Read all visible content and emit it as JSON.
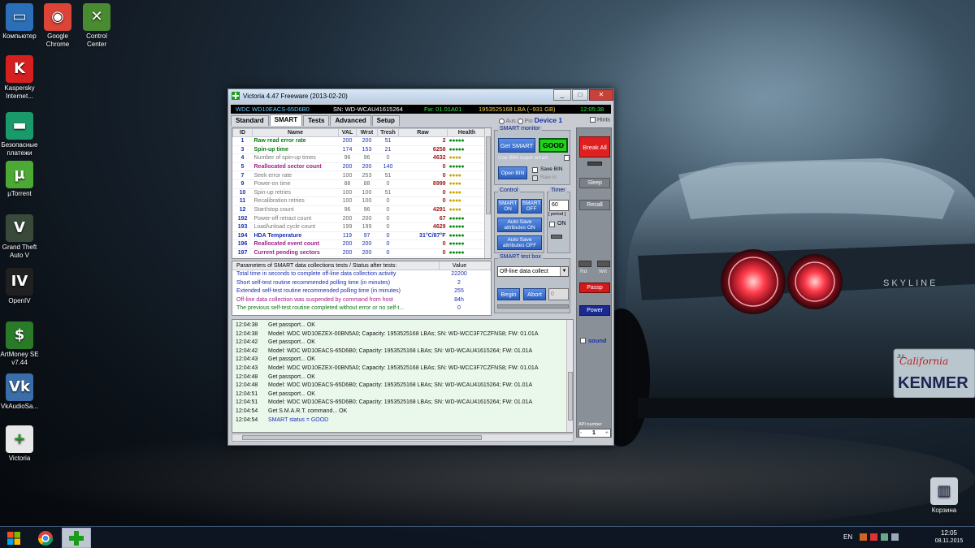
{
  "desktop_icons": [
    {
      "label": "Компьютер",
      "icon": "computer-icon",
      "color": "#2b6fb8"
    },
    {
      "label": "Google Chrome",
      "icon": "chrome-icon",
      "color": "#db4437"
    },
    {
      "label": "Control Center",
      "icon": "tools-icon",
      "color": "#4a8a30"
    },
    {
      "label": "Kaspersky Internet...",
      "icon": "kaspersky-icon",
      "color": "#d62020"
    },
    {
      "label": "Безопасные платежи",
      "icon": "payment-icon",
      "color": "#1a9a6a"
    },
    {
      "label": "µTorrent",
      "icon": "utorrent-icon",
      "color": "#4caa34"
    },
    {
      "label": "Grand Theft Auto V",
      "icon": "gta-icon",
      "color": "#3a4a3a"
    },
    {
      "label": "OpenIV",
      "icon": "openiv-icon",
      "color": "#202020"
    },
    {
      "label": "ArtMoney SE v7.44",
      "icon": "artmoney-icon",
      "color": "#2a7a2a"
    },
    {
      "label": "VkAudioSa...",
      "icon": "vkaudio-icon",
      "color": "#3a6ea8"
    },
    {
      "label": "Victoria",
      "icon": "victoria-icon",
      "color": "#e8e8e8"
    },
    {
      "label": "Корзина",
      "icon": "recycle-bin-icon",
      "color": "#c8d0d8"
    }
  ],
  "window": {
    "title": "Victoria 4.47  Freeware (2013-02-20)",
    "controls": [
      "_",
      "□",
      "✕"
    ]
  },
  "infobar": {
    "model": "WDC WD10EACS-65D6B0",
    "serial": "SN: WD-WCAU41615264",
    "firmware": "Fw: 01.01A01",
    "lba": "1953525168 LBA (~931 GB)",
    "time": "12:05:38"
  },
  "tabs": [
    "Standard",
    "SMART",
    "Tests",
    "Advanced",
    "Setup"
  ],
  "active_tab": "SMART",
  "device_row": {
    "opt1": "Aus",
    "opt2": "Pio",
    "device": "Device 1",
    "hints": "Hints"
  },
  "smart_table": {
    "headers": [
      "ID",
      "Name",
      "VAL",
      "Wrst",
      "Tresh",
      "Raw",
      "Health"
    ],
    "rows": [
      {
        "id": "1",
        "name": "Raw read error rate",
        "val": "200",
        "wrst": "200",
        "tresh": "51",
        "raw": "2",
        "health": "●●●●●",
        "color": "#0a7a12",
        "bold": true,
        "hcolor": "#0a8a12"
      },
      {
        "id": "3",
        "name": "Spin-up time",
        "val": "174",
        "wrst": "153",
        "tresh": "21",
        "raw": "6258",
        "health": "●●●●●",
        "color": "#0a7a12",
        "bold": true,
        "hcolor": "#0a8a12"
      },
      {
        "id": "4",
        "name": "Number of spin-up times",
        "val": "96",
        "wrst": "96",
        "tresh": "0",
        "raw": "4632",
        "health": "●●●●",
        "color": "#777777",
        "bold": false,
        "hcolor": "#c8a800"
      },
      {
        "id": "5",
        "name": "Reallocated sector count",
        "val": "200",
        "wrst": "200",
        "tresh": "140",
        "raw": "0",
        "health": "●●●●●",
        "color": "#a0208a",
        "bold": true,
        "hcolor": "#0a8a12"
      },
      {
        "id": "7",
        "name": "Seek error rate",
        "val": "100",
        "wrst": "253",
        "tresh": "51",
        "raw": "0",
        "health": "●●●●",
        "color": "#777777",
        "bold": false,
        "hcolor": "#c8a800"
      },
      {
        "id": "9",
        "name": "Power-on time",
        "val": "88",
        "wrst": "88",
        "tresh": "0",
        "raw": "8999",
        "health": "●●●●",
        "color": "#777777",
        "bold": false,
        "hcolor": "#c8a800"
      },
      {
        "id": "10",
        "name": "Spin-up retries",
        "val": "100",
        "wrst": "100",
        "tresh": "51",
        "raw": "0",
        "health": "●●●●",
        "color": "#777777",
        "bold": false,
        "hcolor": "#c8a800"
      },
      {
        "id": "11",
        "name": "Recalibration retries",
        "val": "100",
        "wrst": "100",
        "tresh": "0",
        "raw": "0",
        "health": "●●●●",
        "color": "#777777",
        "bold": false,
        "hcolor": "#c8a800"
      },
      {
        "id": "12",
        "name": "Start/stop count",
        "val": "96",
        "wrst": "96",
        "tresh": "0",
        "raw": "4291",
        "health": "●●●●",
        "color": "#777777",
        "bold": false,
        "hcolor": "#c8a800"
      },
      {
        "id": "192",
        "name": "Power-off retract count",
        "val": "200",
        "wrst": "200",
        "tresh": "0",
        "raw": "67",
        "health": "●●●●●",
        "color": "#777777",
        "bold": false,
        "hcolor": "#0a8a12"
      },
      {
        "id": "193",
        "name": "Load/unload cycle count",
        "val": "199",
        "wrst": "199",
        "tresh": "0",
        "raw": "4629",
        "health": "●●●●●",
        "color": "#777777",
        "bold": false,
        "hcolor": "#0a8a12"
      },
      {
        "id": "194",
        "name": "HDA Temperature",
        "val": "119",
        "wrst": "97",
        "tresh": "0",
        "raw": "31°C/87°F",
        "health": "●●●●●",
        "color": "#1a2fb0",
        "bold": true,
        "hcolor": "#0a8a12"
      },
      {
        "id": "196",
        "name": "Reallocated event count",
        "val": "200",
        "wrst": "200",
        "tresh": "0",
        "raw": "0",
        "health": "●●●●●",
        "color": "#a0208a",
        "bold": true,
        "hcolor": "#0a8a12"
      },
      {
        "id": "197",
        "name": "Current pending sectors",
        "val": "200",
        "wrst": "200",
        "tresh": "0",
        "raw": "0",
        "health": "●●●●●",
        "color": "#a0208a",
        "bold": true,
        "hcolor": "#0a8a12"
      }
    ]
  },
  "params": {
    "header_label": "Parameters of SMART data collections tests / Status after tests:",
    "header_value": "Value",
    "rows": [
      {
        "label": "Total time in seconds to complete off-line data collection activity",
        "value": "22200",
        "color": "#1a2fb0"
      },
      {
        "label": "Short self-test routine recommended polling time (in minutes)",
        "value": "2",
        "color": "#1a2fb0"
      },
      {
        "label": "Extended self-test routine recommended polling time (in minutes)",
        "value": "255",
        "color": "#1a2fb0"
      },
      {
        "label": "Off-line data collection was suspended by command from host",
        "value": "84h",
        "color": "#a0208a"
      },
      {
        "label": "The previous self-test routine completed without error or no self-t...",
        "value": "0",
        "color": "#0a7a12"
      }
    ]
  },
  "smart_monitor": {
    "title": "SMART monitor",
    "get_smart": "Get SMART",
    "status": "GOOD",
    "ibm_label": "Use IBM super smart",
    "open_bin": "Open BIN",
    "save_bin": "Save BIN",
    "raw_label": "Raw in"
  },
  "control": {
    "title": "Control",
    "smart_on": "SMART ON",
    "smart_off": "SMART OFF",
    "autosave_on": "Auto Save attributes ON",
    "autosave_off": "Auto Save attributes OFF"
  },
  "timer": {
    "title": "Timer",
    "value": "60",
    "period": "[ period ]",
    "on_label": "ON"
  },
  "test_box": {
    "title": "SMART test box",
    "selected": "Off-line data collect",
    "begin": "Begin",
    "abort": "Abort",
    "counter": "0"
  },
  "side_buttons": {
    "break_all": "Break All",
    "sleep": "Sleep",
    "recall": "Recall",
    "rd": "Rd",
    "wrt": "Wrt",
    "passp": "Passp",
    "power": "Power",
    "sound": "sound",
    "api_label": "API number",
    "api_value": "1",
    "minus": "-",
    "plus": "+"
  },
  "log": [
    {
      "time": "12:04:38",
      "msg": "Get passport... OK",
      "color": "#111111"
    },
    {
      "time": "12:04:38",
      "msg": "Model: WDC WD10EZEX-00BN5A0; Capacity: 1953525168 LBAs; SN: WD-WCC3F7CZFNS8; FW: 01.01A",
      "color": "#111111"
    },
    {
      "time": "12:04:42",
      "msg": "Get passport... OK",
      "color": "#111111"
    },
    {
      "time": "12:04:42",
      "msg": "Model: WDC WD10EACS-65D6B0; Capacity: 1953525168 LBAs; SN: WD-WCAU41615264; FW: 01.01A",
      "color": "#111111"
    },
    {
      "time": "12:04:43",
      "msg": "Get passport... OK",
      "color": "#111111"
    },
    {
      "time": "12:04:43",
      "msg": "Model: WDC WD10EZEX-00BN5A0; Capacity: 1953525168 LBAs; SN: WD-WCC3F7CZFNS8; FW: 01.01A",
      "color": "#111111"
    },
    {
      "time": "12:04:48",
      "msg": "Get passport... OK",
      "color": "#111111"
    },
    {
      "time": "12:04:48",
      "msg": "Model: WDC WD10EACS-65D6B0; Capacity: 1953525168 LBAs; SN: WD-WCAU41615264; FW: 01.01A",
      "color": "#111111"
    },
    {
      "time": "12:04:51",
      "msg": "Get passport... OK",
      "color": "#111111"
    },
    {
      "time": "12:04:51",
      "msg": "Model: WDC WD10EACS-65D6B0; Capacity: 1953525168 LBAs; SN: WD-WCAU41615264; FW: 01.01A",
      "color": "#111111"
    },
    {
      "time": "12:04:54",
      "msg": "Get S.M.A.R.T. command... OK",
      "color": "#111111"
    },
    {
      "time": "12:04:54",
      "msg": "SMART status = GOOD",
      "color": "#1a2fb0"
    }
  ],
  "car": {
    "plate_state": "California",
    "plate": "KENMER",
    "plate_tag": "JUL",
    "badge": "SKYLINE"
  },
  "taskbar": {
    "lang": "EN",
    "time": "12:05",
    "date": "08.11.2015"
  }
}
